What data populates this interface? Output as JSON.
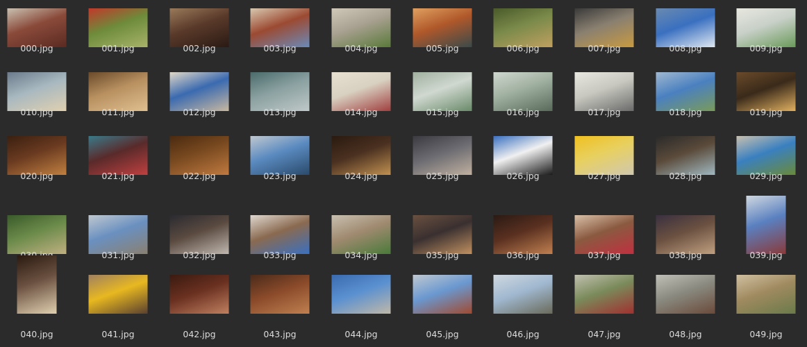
{
  "files": [
    {
      "name": "000.jpg",
      "orient": "landscape",
      "colors": [
        "#8a4a3a",
        "#5a2a22",
        "#c9c0b0"
      ]
    },
    {
      "name": "001.jpg",
      "orient": "landscape",
      "colors": [
        "#6d8b3a",
        "#a8b36a",
        "#c0392b"
      ]
    },
    {
      "name": "002.jpg",
      "orient": "landscape",
      "colors": [
        "#5a3a2a",
        "#2a1a14",
        "#9a7a5a"
      ]
    },
    {
      "name": "003.jpg",
      "orient": "landscape",
      "colors": [
        "#9c4a32",
        "#6a8ab8",
        "#d8c8b0"
      ]
    },
    {
      "name": "004.jpg",
      "orient": "landscape",
      "colors": [
        "#a8a090",
        "#5a7a3a",
        "#d0c8b8"
      ]
    },
    {
      "name": "005.jpg",
      "orient": "landscape",
      "colors": [
        "#b0582a",
        "#3a4a4a",
        "#e0a060"
      ]
    },
    {
      "name": "006.jpg",
      "orient": "landscape",
      "colors": [
        "#7a8a4a",
        "#c0a060",
        "#4a5a2a"
      ]
    },
    {
      "name": "007.jpg",
      "orient": "landscape",
      "colors": [
        "#8a8070",
        "#c89a40",
        "#3a3a3a"
      ]
    },
    {
      "name": "008.jpg",
      "orient": "landscape",
      "colors": [
        "#3a70c0",
        "#e0e8f0",
        "#6a8ab0"
      ]
    },
    {
      "name": "009.jpg",
      "orient": "landscape",
      "colors": [
        "#c8d0c8",
        "#6a9a5a",
        "#e8e8e0"
      ]
    },
    {
      "name": "010.jpg",
      "orient": "landscape",
      "colors": [
        "#a8b8c0",
        "#e0d0b0",
        "#6a7a8a"
      ]
    },
    {
      "name": "011.jpg",
      "orient": "landscape",
      "colors": [
        "#b89060",
        "#e0c090",
        "#6a4a2a"
      ]
    },
    {
      "name": "012.jpg",
      "orient": "landscape",
      "colors": [
        "#3a6ab0",
        "#c8b8a0",
        "#e0d8c8"
      ]
    },
    {
      "name": "013.jpg",
      "orient": "landscape",
      "colors": [
        "#8aa0a0",
        "#c0c8c8",
        "#4a6a6a"
      ]
    },
    {
      "name": "014.jpg",
      "orient": "landscape",
      "colors": [
        "#d8d0c0",
        "#a04040",
        "#e8e0d0"
      ]
    },
    {
      "name": "015.jpg",
      "orient": "landscape",
      "colors": [
        "#d0d8d0",
        "#6a8a6a",
        "#a0b0a0"
      ]
    },
    {
      "name": "016.jpg",
      "orient": "landscape",
      "colors": [
        "#a0b0a0",
        "#5a6a5a",
        "#d0d8d0"
      ]
    },
    {
      "name": "017.jpg",
      "orient": "landscape",
      "colors": [
        "#c8c8c0",
        "#6a6a6a",
        "#e8e8e0"
      ]
    },
    {
      "name": "018.jpg",
      "orient": "landscape",
      "colors": [
        "#4a80c0",
        "#7a9a5a",
        "#a0b8d0"
      ]
    },
    {
      "name": "019.jpg",
      "orient": "landscape",
      "colors": [
        "#3a2a1a",
        "#e0b060",
        "#6a4a2a"
      ]
    },
    {
      "name": "020.jpg",
      "orient": "landscape",
      "colors": [
        "#6a3a20",
        "#c08040",
        "#3a2010"
      ]
    },
    {
      "name": "021.jpg",
      "orient": "landscape",
      "colors": [
        "#5a2a2a",
        "#c04040",
        "#3a7a8a"
      ]
    },
    {
      "name": "022.jpg",
      "orient": "landscape",
      "colors": [
        "#7a4a20",
        "#c07a40",
        "#4a2a10"
      ]
    },
    {
      "name": "023.jpg",
      "orient": "landscape",
      "colors": [
        "#5a8ac0",
        "#2a4a6a",
        "#c0c8d0"
      ]
    },
    {
      "name": "024.jpg",
      "orient": "landscape",
      "colors": [
        "#4a3020",
        "#c09050",
        "#2a1a10"
      ]
    },
    {
      "name": "025.jpg",
      "orient": "landscape",
      "colors": [
        "#6a6a70",
        "#c0b0a0",
        "#3a3a40"
      ]
    },
    {
      "name": "026.jpg",
      "orient": "landscape",
      "colors": [
        "#f0f0f0",
        "#1a1a1a",
        "#3a70c0"
      ]
    },
    {
      "name": "027.jpg",
      "orient": "landscape",
      "colors": [
        "#e8d060",
        "#d0c8b0",
        "#f0c020"
      ]
    },
    {
      "name": "028.jpg",
      "orient": "landscape",
      "colors": [
        "#5a4a3a",
        "#a0b8c0",
        "#2a2a2a"
      ]
    },
    {
      "name": "029.jpg",
      "orient": "landscape",
      "colors": [
        "#3a80c0",
        "#6a8a3a",
        "#c8c0b0"
      ]
    },
    {
      "name": "030.jpg",
      "orient": "landscape",
      "colors": [
        "#6a8a4a",
        "#c0b080",
        "#3a5a2a"
      ]
    },
    {
      "name": "031.jpg",
      "orient": "landscape",
      "colors": [
        "#6a90c0",
        "#8a8070",
        "#c0c8d0"
      ]
    },
    {
      "name": "032.jpg",
      "orient": "landscape",
      "colors": [
        "#5a4a40",
        "#c0b8b0",
        "#2a2a30"
      ]
    },
    {
      "name": "033.jpg",
      "orient": "landscape",
      "colors": [
        "#8a6a50",
        "#3a70c0",
        "#e0d8d0"
      ]
    },
    {
      "name": "034.jpg",
      "orient": "landscape",
      "colors": [
        "#a08a70",
        "#4a7a3a",
        "#c8c0b0"
      ]
    },
    {
      "name": "035.jpg",
      "orient": "landscape",
      "colors": [
        "#3a3030",
        "#c09060",
        "#6a5040"
      ]
    },
    {
      "name": "036.jpg",
      "orient": "landscape",
      "colors": [
        "#5a3020",
        "#c08050",
        "#2a1a14"
      ]
    },
    {
      "name": "037.jpg",
      "orient": "landscape",
      "colors": [
        "#8a5a40",
        "#c03040",
        "#d8c0a8"
      ]
    },
    {
      "name": "038.jpg",
      "orient": "landscape",
      "colors": [
        "#6a5040",
        "#c0a080",
        "#3a3040"
      ]
    },
    {
      "name": "039.jpg",
      "orient": "portrait",
      "colors": [
        "#5a80c0",
        "#8a3a3a",
        "#d0d8e0"
      ]
    },
    {
      "name": "040.jpg",
      "orient": "portrait",
      "colors": [
        "#6a5040",
        "#e0d0b0",
        "#2a1a10"
      ]
    },
    {
      "name": "041.jpg",
      "orient": "landscape",
      "colors": [
        "#e8b820",
        "#5a4030",
        "#a08060"
      ]
    },
    {
      "name": "042.jpg",
      "orient": "landscape",
      "colors": [
        "#6a3020",
        "#c08060",
        "#3a1a10"
      ]
    },
    {
      "name": "043.jpg",
      "orient": "landscape",
      "colors": [
        "#8a4a2a",
        "#c08050",
        "#4a2a1a"
      ]
    },
    {
      "name": "044.jpg",
      "orient": "landscape",
      "colors": [
        "#5a90d0",
        "#c0b8a8",
        "#3a6ab0"
      ]
    },
    {
      "name": "045.jpg",
      "orient": "landscape",
      "colors": [
        "#6a98d0",
        "#a04a30",
        "#c0c8d0"
      ]
    },
    {
      "name": "046.jpg",
      "orient": "landscape",
      "colors": [
        "#a0b8d0",
        "#6a6a5a",
        "#d0d8e0"
      ]
    },
    {
      "name": "047.jpg",
      "orient": "landscape",
      "colors": [
        "#7a8a5a",
        "#a03030",
        "#c0c0b0"
      ]
    },
    {
      "name": "048.jpg",
      "orient": "landscape",
      "colors": [
        "#8a8a80",
        "#6a4a3a",
        "#c0c0b8"
      ]
    },
    {
      "name": "049.jpg",
      "orient": "landscape",
      "colors": [
        "#a08a60",
        "#6a7a4a",
        "#d0c0a0"
      ]
    }
  ]
}
